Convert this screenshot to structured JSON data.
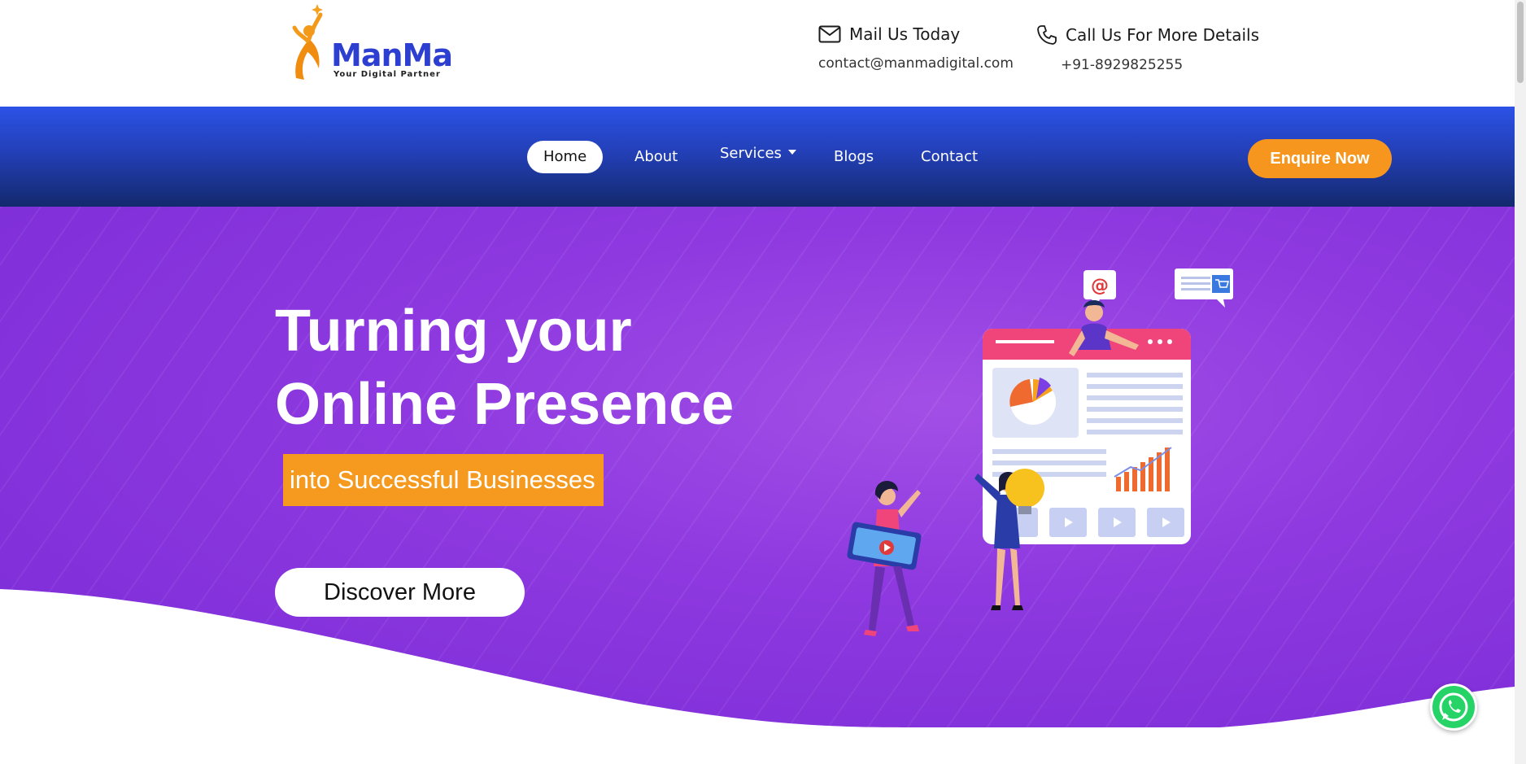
{
  "brand": {
    "name": "ManMa",
    "tagline": "Your Digital Partner",
    "name_color": "#2d3fd0",
    "accent_color": "#f7961e"
  },
  "contact": {
    "mail_title": "Mail Us Today",
    "mail_value": "contact@manmadigital.com",
    "call_title": "Call Us For More Details",
    "call_value": "+91-8929825255",
    "mail_icon": "envelope-icon",
    "call_icon": "phone-icon"
  },
  "nav": {
    "items": [
      {
        "label": "Home",
        "active": true
      },
      {
        "label": "About"
      },
      {
        "label": "Services",
        "has_dropdown": true
      },
      {
        "label": "Blogs"
      },
      {
        "label": "Contact"
      }
    ],
    "cta": "Enquire Now"
  },
  "hero": {
    "title_line1": "Turning your",
    "title_line2": "Online Presence",
    "highlight": "into Successful Businesses",
    "button": "Discover More",
    "background_color": "#8e39e0",
    "highlight_color": "#f59a1e"
  },
  "floating": {
    "whatsapp_icon": "whatsapp-icon"
  }
}
